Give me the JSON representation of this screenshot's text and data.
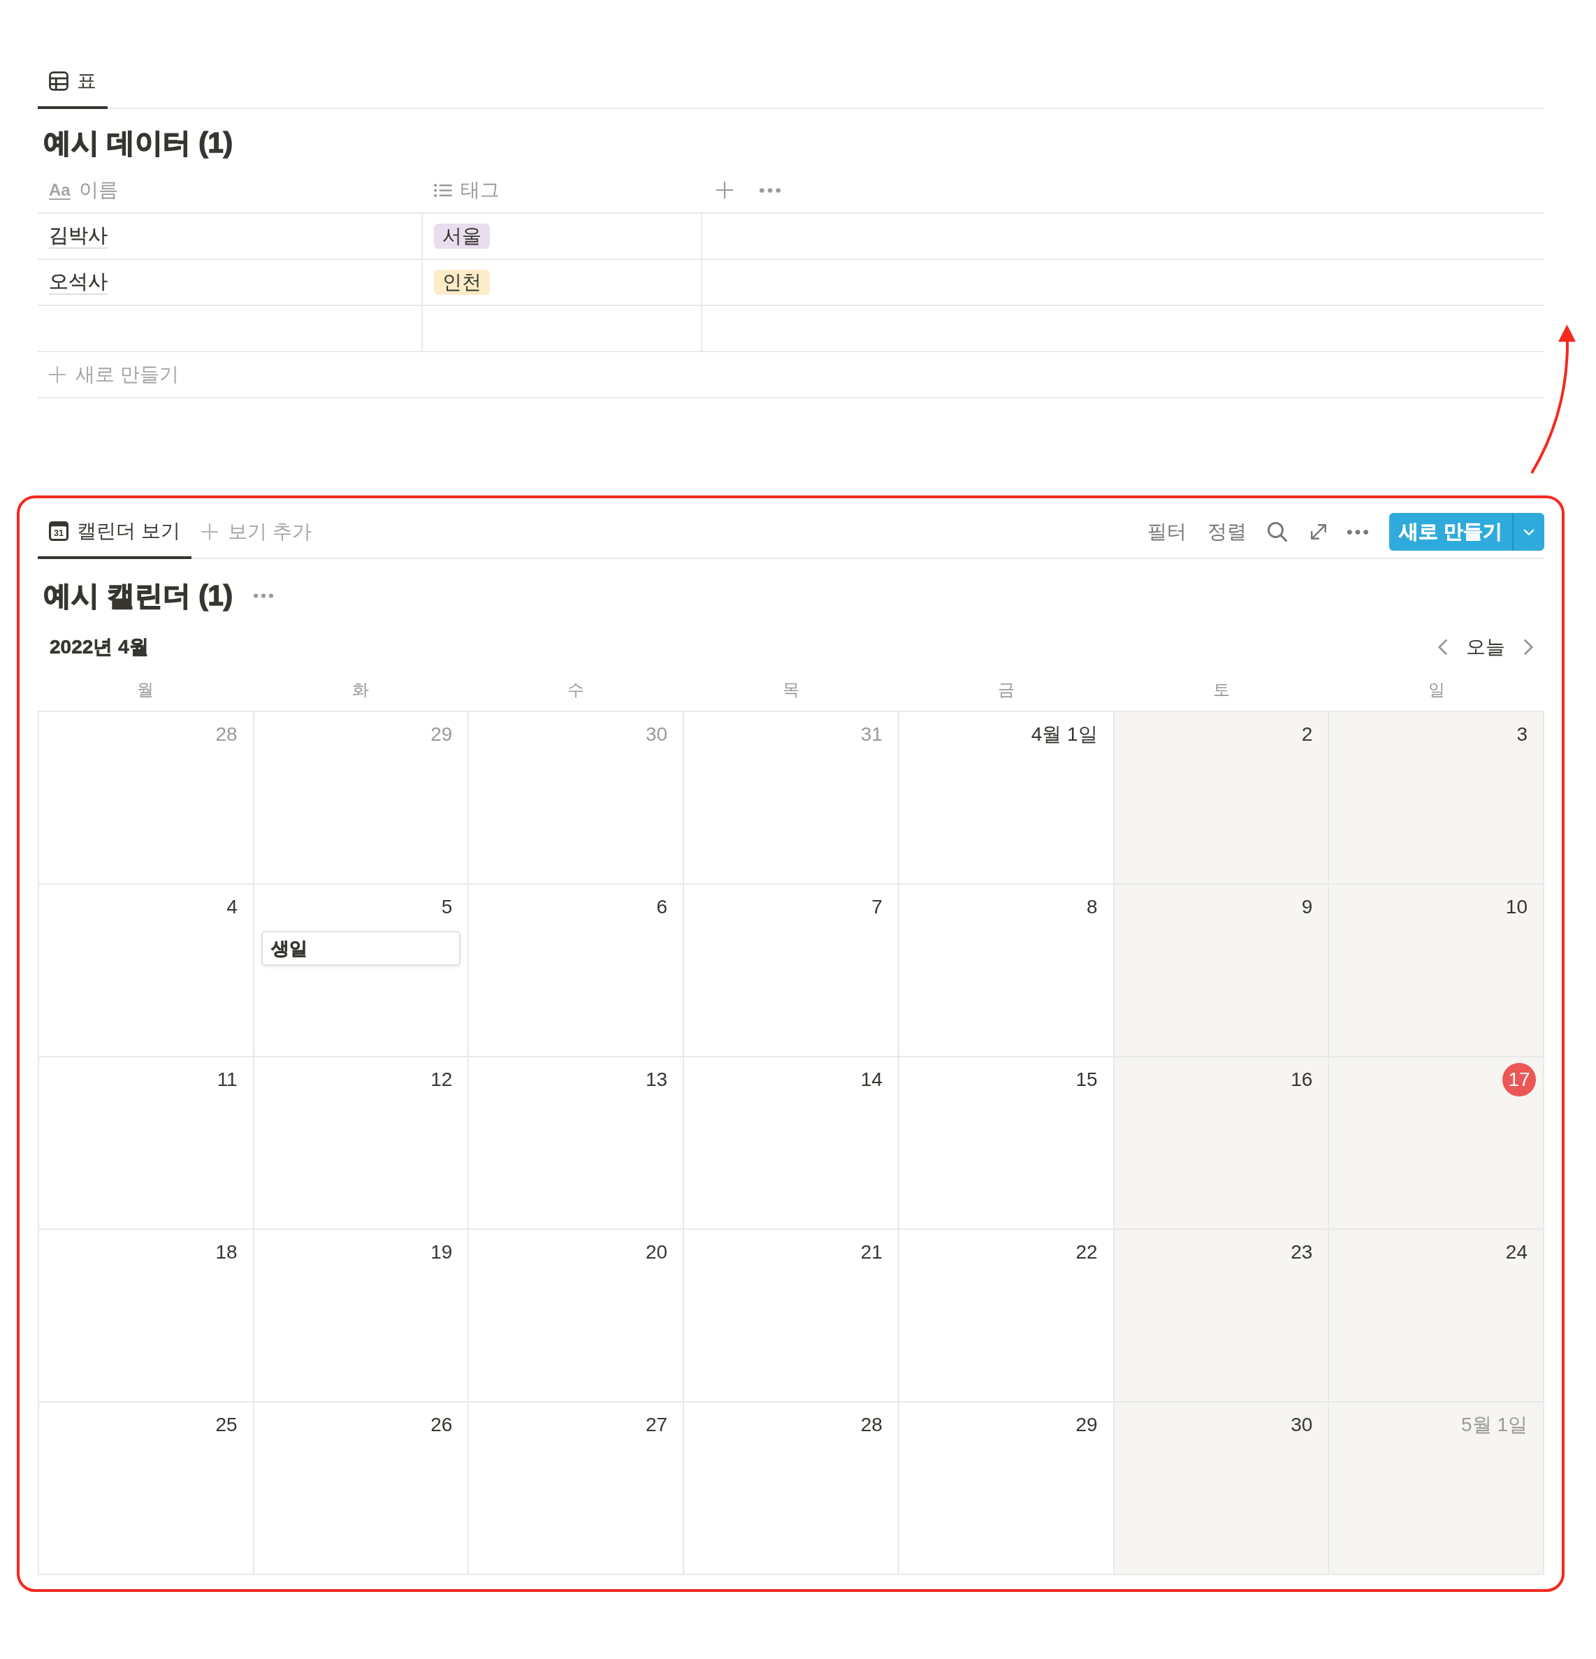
{
  "table_view": {
    "tabs": [
      {
        "label": "표",
        "selected": true
      }
    ],
    "title": "예시 데이터 (1)",
    "columns": [
      {
        "kind": "title",
        "icon_text": "Aa",
        "label": "이름"
      },
      {
        "kind": "multi_select",
        "label": "태그"
      }
    ],
    "rows": [
      {
        "kind": "entry",
        "name": "김박사",
        "tags": [
          {
            "label": "서울",
            "color": "#e8deee"
          }
        ]
      },
      {
        "kind": "entry",
        "name": "오석사",
        "tags": [
          {
            "label": "인천",
            "color": "#fdecc8"
          }
        ]
      },
      {
        "kind": "blank"
      }
    ],
    "new_row": "새로 만들기"
  },
  "calendar_view": {
    "tabs": [
      {
        "label": "캘린더 보기",
        "icon_text": "31",
        "selected": true
      }
    ],
    "add_view": "보기 추가",
    "toolbar": {
      "filter": "필터",
      "sort": "정렬"
    },
    "new_button": "새로 만들기",
    "title": "예시 캘린더 (1)",
    "month": "2022년 4월",
    "today_button": "오늘",
    "weekdays": [
      {
        "label": "월",
        "weekend": false
      },
      {
        "label": "화",
        "weekend": false
      },
      {
        "label": "수",
        "weekend": false
      },
      {
        "label": "목",
        "weekend": false
      },
      {
        "label": "금",
        "weekend": false
      },
      {
        "label": "토",
        "weekend": true
      },
      {
        "label": "일",
        "weekend": true
      }
    ],
    "weeks": [
      {
        "days": [
          {
            "label": "28",
            "in_month": false,
            "today": false
          },
          {
            "label": "29",
            "in_month": false,
            "today": false
          },
          {
            "label": "30",
            "in_month": false,
            "today": false
          },
          {
            "label": "31",
            "in_month": false,
            "today": false
          },
          {
            "label": "4월 1일",
            "in_month": true,
            "today": false
          },
          {
            "label": "2",
            "in_month": true,
            "today": false
          },
          {
            "label": "3",
            "in_month": true,
            "today": false
          }
        ]
      },
      {
        "days": [
          {
            "label": "4",
            "in_month": true,
            "today": false
          },
          {
            "label": "5",
            "in_month": true,
            "today": false,
            "events": [
              {
                "title": "생일"
              }
            ]
          },
          {
            "label": "6",
            "in_month": true,
            "today": false
          },
          {
            "label": "7",
            "in_month": true,
            "today": false
          },
          {
            "label": "8",
            "in_month": true,
            "today": false
          },
          {
            "label": "9",
            "in_month": true,
            "today": false
          },
          {
            "label": "10",
            "in_month": true,
            "today": false
          }
        ]
      },
      {
        "days": [
          {
            "label": "11",
            "in_month": true,
            "today": false
          },
          {
            "label": "12",
            "in_month": true,
            "today": false
          },
          {
            "label": "13",
            "in_month": true,
            "today": false
          },
          {
            "label": "14",
            "in_month": true,
            "today": false
          },
          {
            "label": "15",
            "in_month": true,
            "today": false
          },
          {
            "label": "16",
            "in_month": true,
            "today": false
          },
          {
            "label": "17",
            "in_month": true,
            "today": true
          }
        ]
      },
      {
        "days": [
          {
            "label": "18",
            "in_month": true,
            "today": false
          },
          {
            "label": "19",
            "in_month": true,
            "today": false
          },
          {
            "label": "20",
            "in_month": true,
            "today": false
          },
          {
            "label": "21",
            "in_month": true,
            "today": false
          },
          {
            "label": "22",
            "in_month": true,
            "today": false
          },
          {
            "label": "23",
            "in_month": true,
            "today": false
          },
          {
            "label": "24",
            "in_month": true,
            "today": false
          }
        ]
      },
      {
        "days": [
          {
            "label": "25",
            "in_month": true,
            "today": false
          },
          {
            "label": "26",
            "in_month": true,
            "today": false
          },
          {
            "label": "27",
            "in_month": true,
            "today": false
          },
          {
            "label": "28",
            "in_month": true,
            "today": false
          },
          {
            "label": "29",
            "in_month": true,
            "today": false
          },
          {
            "label": "30",
            "in_month": true,
            "today": false
          },
          {
            "label": "5월 1일",
            "in_month": false,
            "today": false
          }
        ]
      }
    ]
  },
  "annotations": {
    "highlight_frame": true,
    "arrow": true
  }
}
